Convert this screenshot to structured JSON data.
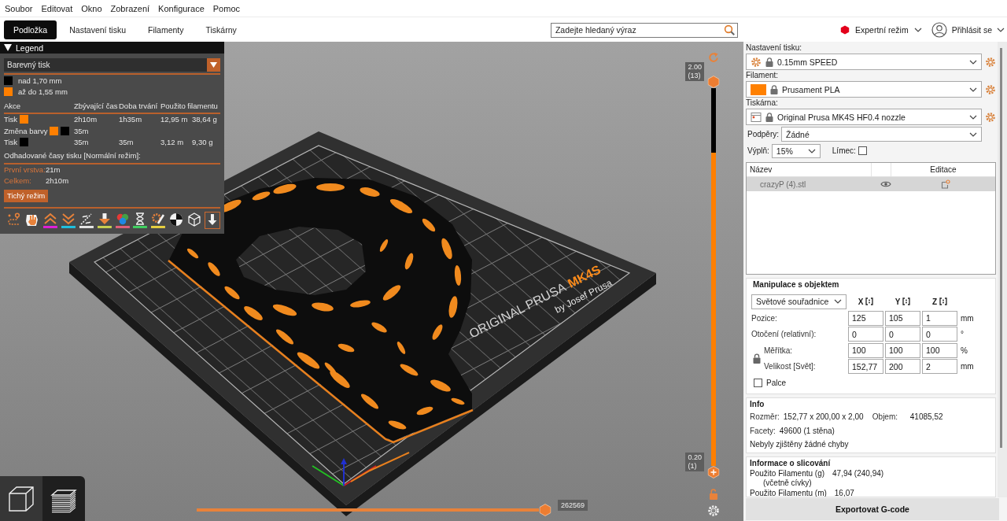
{
  "menu": [
    "Soubor",
    "Editovat",
    "Okno",
    "Zobrazení",
    "Konfigurace",
    "Pomoc"
  ],
  "tabs": [
    {
      "label": "Podložka",
      "selected": true
    },
    {
      "label": "Nastavení tisku",
      "selected": false
    },
    {
      "label": "Filamenty",
      "selected": false
    },
    {
      "label": "Tiskárny",
      "selected": false
    }
  ],
  "search": {
    "placeholder": "Zadejte hledaný výraz"
  },
  "mode": {
    "label": "Expertní režim"
  },
  "account": {
    "label": "Přihlásit se"
  },
  "legend": {
    "title": "Legend",
    "expanded": true,
    "view_type": "Barevný tisk",
    "ranges": [
      {
        "label": "nad 1,70 mm",
        "color": "#000000"
      },
      {
        "label": "až do 1,55 mm",
        "color": "#ff7f00"
      }
    ],
    "columns": [
      "Akce",
      "Zbývající čas",
      "Doba trvání",
      "Použito filamentu"
    ],
    "rows": [
      {
        "action": "Tisk",
        "swatches": [
          {
            "color": "#ff7f00"
          }
        ],
        "remaining": "2h10m",
        "duration": "1h35m",
        "length": "12,95 m",
        "weight": "38,64 g"
      },
      {
        "action": "Změna barvy",
        "swatches": [
          {
            "color": "#ff7f00"
          },
          {
            "color": "#000000"
          }
        ],
        "remaining": "35m"
      },
      {
        "action": "Tisk",
        "swatches": [
          {
            "color": "#000000"
          }
        ],
        "remaining": "35m",
        "duration": "35m",
        "length": "3,12 m",
        "weight": "9,30 g"
      }
    ],
    "estimate_title": "Odhadované časy tisku [Normální režim]:",
    "estimates": [
      {
        "label": "První vrstva:",
        "value": "21m"
      },
      {
        "label": "Celkem:",
        "value": "2h10m"
      }
    ],
    "mode_button": "Tichý režim",
    "options": [
      {
        "kind": "travel",
        "selected": false
      },
      {
        "kind": "wipe",
        "selected": false
      },
      {
        "kind": "retractions",
        "color": "#e020d8",
        "selected": false
      },
      {
        "kind": "deretractions",
        "color": "#20c0e0",
        "selected": false
      },
      {
        "kind": "seams",
        "color": "#e6e6e6",
        "selected": false
      },
      {
        "kind": "tool_changes",
        "color": "#c8d050",
        "selected": false
      },
      {
        "kind": "color_changes",
        "color": "#e0607a",
        "selected": false
      },
      {
        "kind": "pauses",
        "color": "#40d060",
        "selected": false
      },
      {
        "kind": "custom_gcode",
        "color": "#e8d040",
        "selected": false
      },
      {
        "kind": "center_of_gravity",
        "selected": false
      },
      {
        "kind": "shells",
        "selected": false
      },
      {
        "kind": "tool_marker",
        "selected": true
      }
    ]
  },
  "viewport": {
    "bed_logo": {
      "brand": "ORIGINAL PRUSA",
      "model": "MK4S",
      "byline": "by Josef Prusa"
    },
    "layer_slider": {
      "color": "#ff7f00",
      "color_change": {
        "color": "#000000",
        "level": 0.17
      },
      "thumbs": [
        {
          "kind": "plain",
          "value": "2.00",
          "layer": "(13)",
          "level": 1
        },
        {
          "kind": "add",
          "value": "0.20",
          "layer": "(1)",
          "level": 0
        }
      ]
    },
    "move_slider": {
      "value": "262569",
      "level": 1
    },
    "view_buttons": [
      {
        "kind": "model",
        "selected": false
      },
      {
        "kind": "preview",
        "selected": true
      }
    ]
  },
  "sidebar": {
    "presets": [
      {
        "kind": "print",
        "label": "Nastavení tisku:",
        "value": "0.15mm SPEED"
      },
      {
        "kind": "filament",
        "label": "Filament:",
        "value": "Prusament PLA",
        "color": "#ff8000"
      },
      {
        "kind": "printer",
        "label": "Tiskárna:",
        "value": "Original Prusa MK4S HF0.4 nozzle"
      }
    ],
    "supports": {
      "label": "Podpěry:",
      "value": "Žádné"
    },
    "infill": {
      "label": "Výplň:",
      "value": "15%"
    },
    "brim": {
      "label": "Límec:",
      "checked": false
    },
    "objects": {
      "columns": {
        "name": "Název",
        "edit": "Editace"
      },
      "rows": [
        {
          "name": "crazyP (4).stl",
          "selected": true
        }
      ]
    },
    "manipulation": {
      "title": "Manipulace s objektem",
      "coordinates": "Světové souřadnice",
      "axes": [
        "X",
        "Y",
        "Z"
      ],
      "scale_locked": true,
      "rows": [
        {
          "kind": "plain",
          "label": "Pozice:",
          "values": [
            "125",
            "105",
            "1"
          ],
          "unit": "mm"
        },
        {
          "kind": "plain",
          "label": "Otočení (relativní):",
          "values": [
            "0",
            "0",
            "0"
          ],
          "unit": "°"
        },
        {
          "kind": "scale",
          "label": "Měřítka:",
          "values": [
            "100",
            "100",
            "100"
          ],
          "unit": "%"
        },
        {
          "kind": "scale",
          "label": "Velikost [Svět]:",
          "values": [
            "152,77",
            "200",
            "2"
          ],
          "unit": "mm"
        }
      ],
      "inches": {
        "label": "Palce",
        "checked": false
      }
    },
    "info": {
      "title": "Info",
      "size_label": "Rozměr:",
      "size": "152,77 x 200,00 x 2,00",
      "volume_label": "Objem:",
      "volume": "41085,52",
      "facets_label": "Facety:",
      "facets": "49600 (1 stěna)",
      "status": "Nebyly zjištěny žádné chyby"
    },
    "slicing": {
      "title": "Informace o slicování",
      "rows": [
        {
          "label": "Použito Filamentu (g)",
          "note": "(včetně cívky)",
          "value": "47,94 (240,94)"
        },
        {
          "label": "Použito Filamentu (m)",
          "value": "16,07"
        }
      ]
    },
    "export_button": "Exportovat G-code"
  }
}
